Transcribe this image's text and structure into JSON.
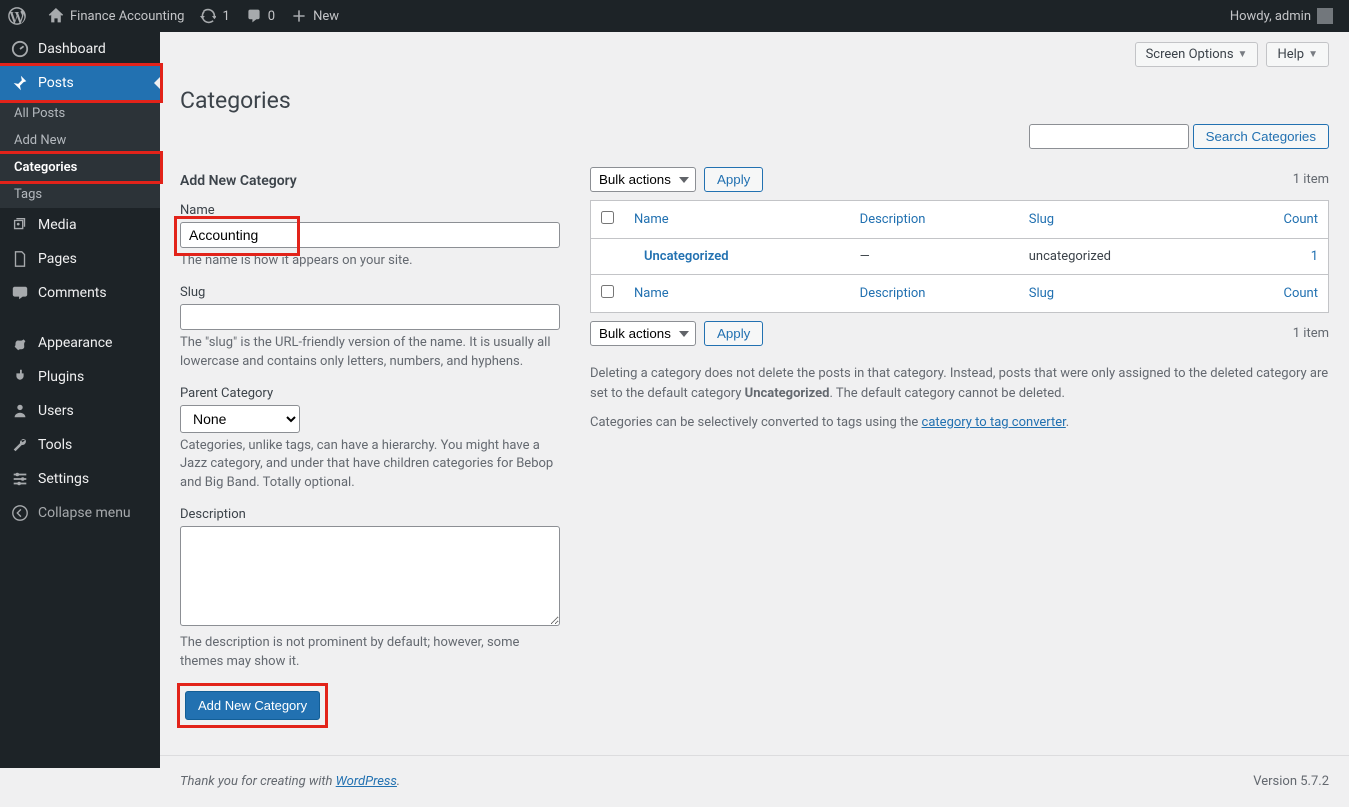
{
  "adminbar": {
    "site_name": "Finance Accounting",
    "updates": "1",
    "comments": "0",
    "new": "New",
    "howdy": "Howdy, admin"
  },
  "menu": {
    "dashboard": "Dashboard",
    "posts": "Posts",
    "all_posts": "All Posts",
    "add_new": "Add New",
    "categories": "Categories",
    "tags": "Tags",
    "media": "Media",
    "pages": "Pages",
    "comments": "Comments",
    "appearance": "Appearance",
    "plugins": "Plugins",
    "users": "Users",
    "tools": "Tools",
    "settings": "Settings",
    "collapse": "Collapse menu"
  },
  "screen": {
    "options": "Screen Options",
    "help": "Help"
  },
  "page": {
    "title": "Categories"
  },
  "form": {
    "heading": "Add New Category",
    "name_label": "Name",
    "name_value": "Accounting",
    "name_help": "The name is how it appears on your site.",
    "slug_label": "Slug",
    "slug_value": "",
    "slug_help": "The \"slug\" is the URL-friendly version of the name. It is usually all lowercase and contains only letters, numbers, and hyphens.",
    "parent_label": "Parent Category",
    "parent_value": "None",
    "parent_help": "Categories, unlike tags, can have a hierarchy. You might have a Jazz category, and under that have children categories for Bebop and Big Band. Totally optional.",
    "desc_label": "Description",
    "desc_value": "",
    "desc_help": "The description is not prominent by default; however, some themes may show it.",
    "submit": "Add New Category"
  },
  "search": {
    "button": "Search Categories"
  },
  "table": {
    "bulk": "Bulk actions",
    "apply": "Apply",
    "count": "1 item",
    "cols": {
      "name": "Name",
      "desc": "Description",
      "slug": "Slug",
      "count": "Count"
    },
    "rows": [
      {
        "name": "Uncategorized",
        "desc": "—",
        "slug": "uncategorized",
        "count": "1"
      }
    ]
  },
  "notes": {
    "line1_a": "Deleting a category does not delete the posts in that category. Instead, posts that were only assigned to the deleted category are set to the default category ",
    "line1_b": "Uncategorized",
    "line1_c": ". The default category cannot be deleted.",
    "line2_a": "Categories can be selectively converted to tags using the ",
    "line2_link": "category to tag converter",
    "line2_b": "."
  },
  "footer": {
    "thanks_a": "Thank you for creating with ",
    "wp": "WordPress",
    "thanks_b": ".",
    "version": "Version 5.7.2"
  }
}
